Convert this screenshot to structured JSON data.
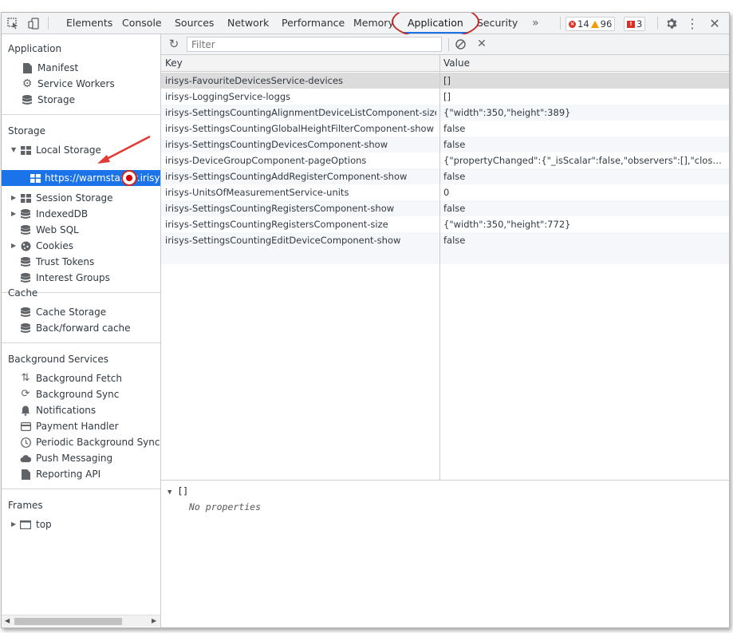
{
  "toolbar": {
    "tabs": [
      "Elements",
      "Console",
      "Sources",
      "Network",
      "Performance",
      "Memory",
      "Application",
      "Security"
    ],
    "more": "»",
    "errors": "14",
    "warnings": "96",
    "issues": "3",
    "active_tab": "Application"
  },
  "sidebar": {
    "application": {
      "title": "Application",
      "items": [
        "Manifest",
        "Service Workers",
        "Storage"
      ]
    },
    "storage": {
      "title": "Storage",
      "local_storage": "Local Storage",
      "local_origin": "https://warmstarter.irisys.c",
      "items": [
        "Session Storage",
        "IndexedDB",
        "Web SQL",
        "Cookies",
        "Trust Tokens",
        "Interest Groups"
      ]
    },
    "cache": {
      "title": "Cache",
      "items": [
        "Cache Storage",
        "Back/forward cache"
      ]
    },
    "background": {
      "title": "Background Services",
      "items": [
        "Background Fetch",
        "Background Sync",
        "Notifications",
        "Payment Handler",
        "Periodic Background Sync",
        "Push Messaging",
        "Reporting API"
      ]
    },
    "frames": {
      "title": "Frames",
      "top": "top"
    }
  },
  "main": {
    "filter_placeholder": "Filter",
    "columns": {
      "key": "Key",
      "value": "Value"
    },
    "rows": [
      {
        "key": "irisys-FavouriteDevicesService-devices",
        "value": "[]"
      },
      {
        "key": "irisys-LoggingService-loggs",
        "value": "[]"
      },
      {
        "key": "irisys-SettingsCountingAlignmentDeviceListComponent-size",
        "value": "{\"width\":350,\"height\":389}"
      },
      {
        "key": "irisys-SettingsCountingGlobalHeightFilterComponent-show",
        "value": "false"
      },
      {
        "key": "irisys-SettingsCountingDevicesComponent-show",
        "value": "false"
      },
      {
        "key": "irisys-DeviceGroupComponent-pageOptions",
        "value": "{\"propertyChanged\":{\"_isScalar\":false,\"observers\":[],\"closed\":fal…"
      },
      {
        "key": "irisys-SettingsCountingAddRegisterComponent-show",
        "value": "false"
      },
      {
        "key": "irisys-UnitsOfMeasurementService-units",
        "value": "0"
      },
      {
        "key": "irisys-SettingsCountingRegistersComponent-show",
        "value": "false"
      },
      {
        "key": "irisys-SettingsCountingRegistersComponent-size",
        "value": "{\"width\":350,\"height\":772}"
      },
      {
        "key": "irisys-SettingsCountingEditDeviceComponent-show",
        "value": "false"
      }
    ],
    "preview": {
      "value": "[]",
      "empty_text": "No properties"
    }
  }
}
